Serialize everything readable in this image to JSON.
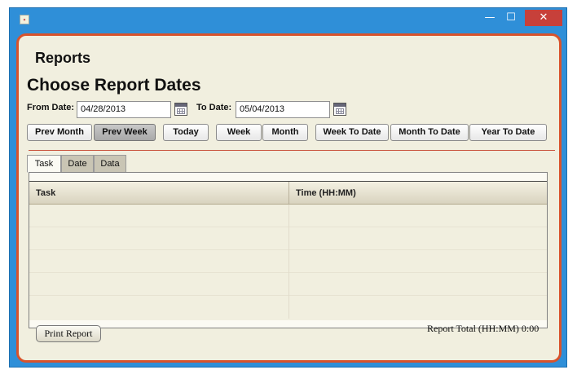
{
  "window": {
    "minimize": "—",
    "maximize": "☐",
    "close": "✕"
  },
  "header": {
    "section": "Reports",
    "title": "Choose Report Dates"
  },
  "dates": {
    "from_label": "From Date:",
    "from_value": "04/28/2013",
    "to_label": "To Date:",
    "to_value": "05/04/2013"
  },
  "quick_buttons": [
    "Prev Month",
    "Prev Week",
    "Today",
    "Week",
    "Month",
    "Week To Date",
    "Month To Date",
    "Year To Date"
  ],
  "tabs": [
    "Task",
    "Date",
    "Data"
  ],
  "table": {
    "columns": [
      "Task",
      "Time (HH:MM)"
    ],
    "rows": []
  },
  "footer": {
    "print_label": "Print Report",
    "total_text": "Report Total (HH:MM) 0:00"
  }
}
